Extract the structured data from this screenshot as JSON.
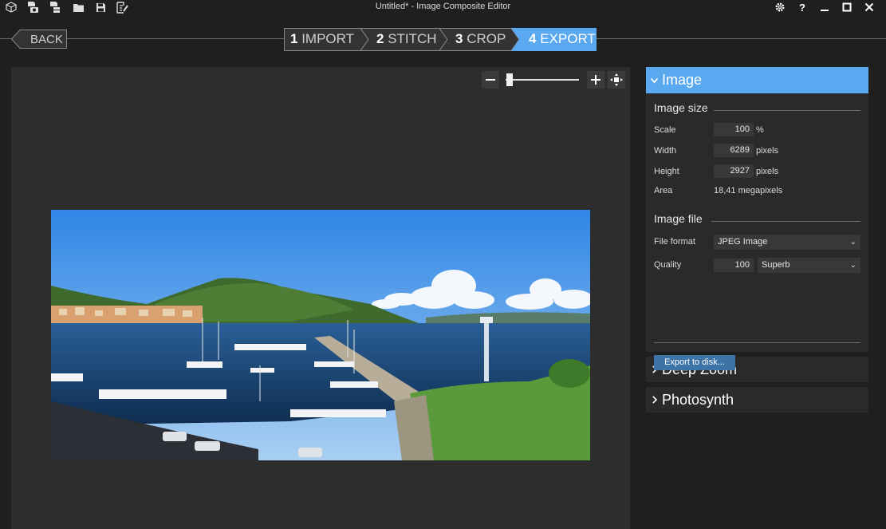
{
  "app": {
    "title": "Untitled* - Image Composite Editor"
  },
  "titlebar": {
    "left_icons": [
      "cube-icon",
      "camera-file-icon",
      "layers-file-icon",
      "folder-icon",
      "save-icon",
      "export-icon"
    ],
    "right_icons": [
      "gear-icon",
      "help-icon",
      "minimize-icon",
      "maximize-icon",
      "close-icon"
    ]
  },
  "nav": {
    "back_label": "BACK",
    "steps": [
      {
        "num": "1",
        "label": "IMPORT",
        "active": false
      },
      {
        "num": "2",
        "label": "STITCH",
        "active": false
      },
      {
        "num": "3",
        "label": "CROP",
        "active": false
      },
      {
        "num": "4",
        "label": "EXPORT",
        "active": true
      }
    ]
  },
  "zoom": {
    "minus": "−",
    "plus": "+",
    "level_fraction": 0.05
  },
  "panel": {
    "image": {
      "header": "Image",
      "image_size": {
        "title": "Image size",
        "scale_label": "Scale",
        "scale_value": "100",
        "scale_unit": "%",
        "width_label": "Width",
        "width_value": "6289",
        "width_unit": "pixels",
        "height_label": "Height",
        "height_value": "2927",
        "height_unit": "pixels",
        "area_label": "Area",
        "area_value": "18,41 megapixels"
      },
      "image_file": {
        "title": "Image file",
        "format_label": "File format",
        "format_value": "JPEG Image",
        "quality_label": "Quality",
        "quality_value": "100",
        "quality_preset": "Superb"
      },
      "export_button": "Export to disk..."
    },
    "deep_zoom": {
      "header": "Deep Zoom"
    },
    "photosynth": {
      "header": "Photosynth"
    }
  },
  "colors": {
    "accent": "#5aa9f0",
    "export_button": "#3d74a8",
    "background": "#1f1f1f",
    "panel": "#2a2a2a"
  }
}
